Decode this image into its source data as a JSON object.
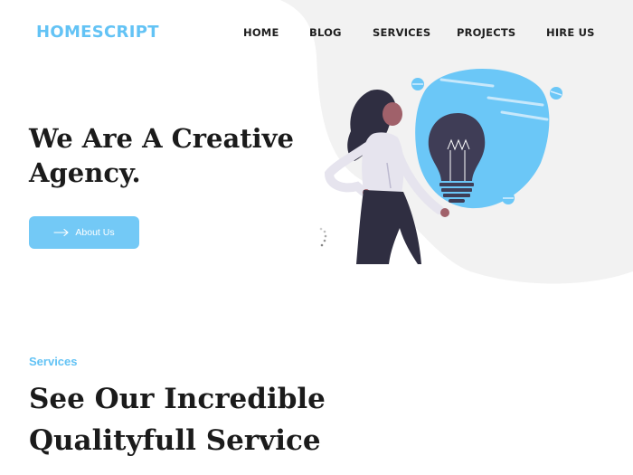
{
  "header": {
    "logo": "HOMESCRIPT",
    "nav": [
      {
        "label": "HOME"
      },
      {
        "label": "BLOG"
      },
      {
        "label": "SERVICES"
      },
      {
        "label": "PROJECTS"
      },
      {
        "label": "HIRE US"
      }
    ]
  },
  "hero": {
    "title_line1": "We Are A Creative",
    "title_line2": "Agency.",
    "button_label": "About Us"
  },
  "services": {
    "kicker": "Services",
    "title_line1": "See Our Incredible",
    "title_line2": "Qualityfull Service"
  },
  "colors": {
    "accent": "#63c3f5",
    "button": "#73c9f6",
    "blob": "#f2f2f2",
    "text": "#1b1b1b"
  },
  "icons": {
    "button_icon": "arrow-right-icon",
    "illustration": "woman-holding-lightbulb-illustration",
    "loader": "loading-spinner-icon"
  }
}
